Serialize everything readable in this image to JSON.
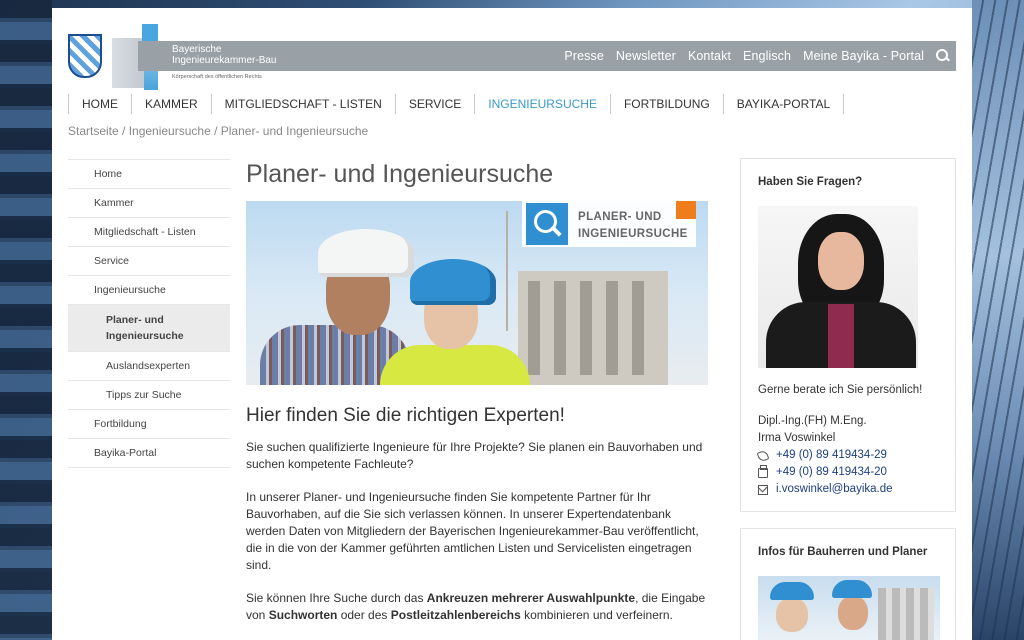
{
  "brand": {
    "line1": "Bayerische",
    "line2": "Ingenieurekammer-Bau",
    "tagline": "Körperschaft des öffentlichen Rechts"
  },
  "topnav": [
    "Presse",
    "Newsletter",
    "Kontakt",
    "Englisch",
    "Meine Bayika - Portal"
  ],
  "mainnav": [
    {
      "label": "HOME",
      "active": false
    },
    {
      "label": "KAMMER",
      "active": false
    },
    {
      "label": "MITGLIEDSCHAFT - LISTEN",
      "active": false
    },
    {
      "label": "SERVICE",
      "active": false
    },
    {
      "label": "INGENIEURSUCHE",
      "active": true
    },
    {
      "label": "FORTBILDUNG",
      "active": false
    },
    {
      "label": "BAYIKA-PORTAL",
      "active": false
    }
  ],
  "breadcrumb": "Startseite / Ingenieursuche / Planer- und Ingenieursuche",
  "sidebar": [
    "Home",
    "Kammer",
    "Mitgliedschaft - Listen",
    "Service",
    "Ingenieursuche",
    "Planer- und Ingenieursuche",
    "Auslandsexperten",
    "Tipps zur Suche",
    "Fortbildung",
    "Bayika-Portal"
  ],
  "content": {
    "title": "Planer- und Ingenieursuche",
    "hero_badge_line1": "PLANER- UND",
    "hero_badge_line2": "INGENIEURSUCHE",
    "subtitle": "Hier finden Sie die richtigen Experten!",
    "p1": "Sie suchen qualifizierte Ingenieure für Ihre Projekte? Sie planen ein Bauvorhaben und suchen kompetente Fachleute?",
    "p2": "In unserer Planer- und Ingenieursuche finden Sie kompetente Partner für Ihr Bauvorhaben, auf die Sie sich verlassen können. In unserer Expertendatenbank werden Daten von Mitgliedern der Bayerischen Ingenieurekammer-Bau veröffentlicht, die in die von der Kammer geführten amtlichen Listen und Servicelisten eingetragen sind.",
    "p3_a": "Sie können Ihre Suche durch das ",
    "p3_b": "Ankreuzen mehrerer Auswahlpunkte",
    "p3_c": ", die Eingabe von ",
    "p3_d": "Suchworten",
    "p3_e": " oder des ",
    "p3_f": "Postleitzahlenbereichs",
    "p3_g": " kombinieren und verfeinern."
  },
  "contact_box": {
    "title": "Haben Sie Fragen?",
    "intro": "Gerne berate ich Sie persönlich!",
    "degree": "Dipl.-Ing.(FH) M.Eng.",
    "name": "Irma Voswinkel",
    "phone": "+49 (0) 89 419434-29",
    "fax": "+49 (0) 89 419434-20",
    "email": "i.voswinkel@bayika.de"
  },
  "info_box": {
    "title": "Infos für Bauherren und Planer"
  },
  "colors": {
    "accent": "#3a9ac8",
    "orange": "#ef7d1c",
    "header_gray": "#9aa1a6"
  }
}
